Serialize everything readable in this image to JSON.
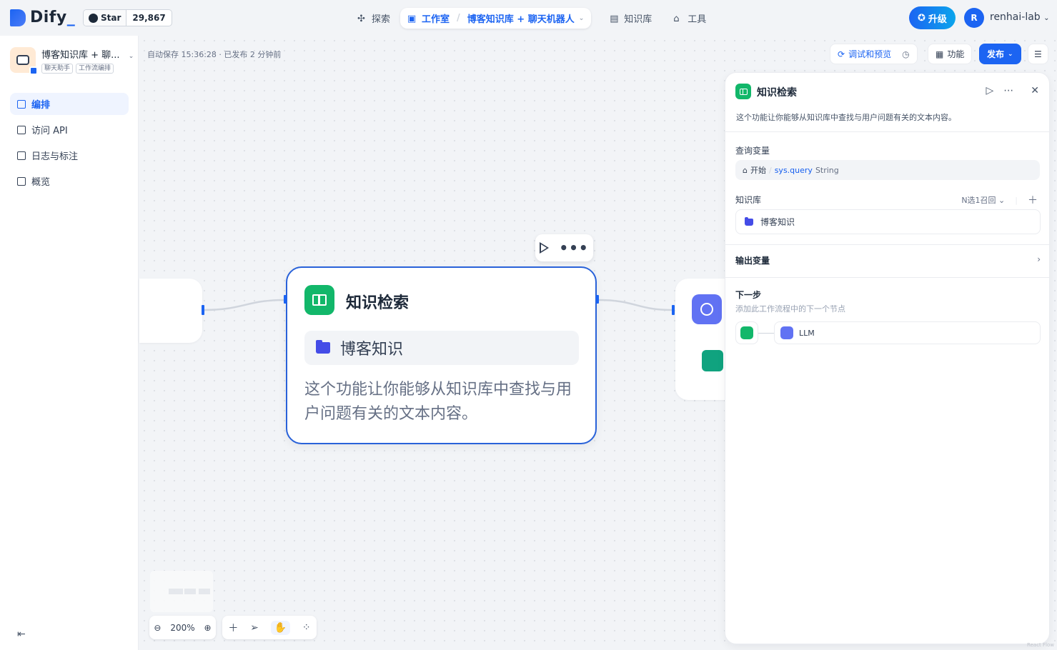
{
  "brand": {
    "name": "Dify",
    "suffix": "_"
  },
  "github": {
    "star_label": "Star",
    "count": "29,867"
  },
  "nav": {
    "explore": "探索",
    "studio": "工作室",
    "app_name": "博客知识库 + 聊天机器人",
    "knowledge": "知识库",
    "tools": "工具"
  },
  "header": {
    "upgrade": "升级",
    "avatar_letter": "R",
    "username": "renhai-lab"
  },
  "sidebar": {
    "app_title": "博客知识库 + 聊...",
    "tags": [
      "聊天助手",
      "工作流编排"
    ],
    "items": [
      {
        "label": "编排",
        "active": true
      },
      {
        "label": "访问 API",
        "active": false
      },
      {
        "label": "日志与标注",
        "active": false
      },
      {
        "label": "概览",
        "active": false
      }
    ]
  },
  "canvas": {
    "autosave": "自动保存 15:36:28 · 已发布 2 分钟前",
    "debug_preview": "调试和预览",
    "features": "功能",
    "publish": "发布",
    "zoom": "200%"
  },
  "node": {
    "title": "知识检索",
    "dataset": "博客知识",
    "description": "这个功能让你能够从知识库中查找与用户问题有关的文本内容。"
  },
  "panel": {
    "title": "知识检索",
    "description": "这个功能让你能够从知识库中查找与用户问题有关的文本内容。",
    "query_label": "查询变量",
    "query_source": "开始",
    "query_var": "sys.query",
    "query_type": "String",
    "kb_label": "知识库",
    "kb_mode": "N选1召回",
    "kb_item": "博客知识",
    "output_label": "输出变量",
    "next_title": "下一步",
    "next_sub": "添加此工作流程中的下一个节点",
    "next_node": "LLM"
  },
  "footer": {
    "reactflow": "React Flow"
  },
  "colors": {
    "accent": "#1c64f2",
    "knowledge": "#12b76a",
    "llm": "#6172f3"
  }
}
